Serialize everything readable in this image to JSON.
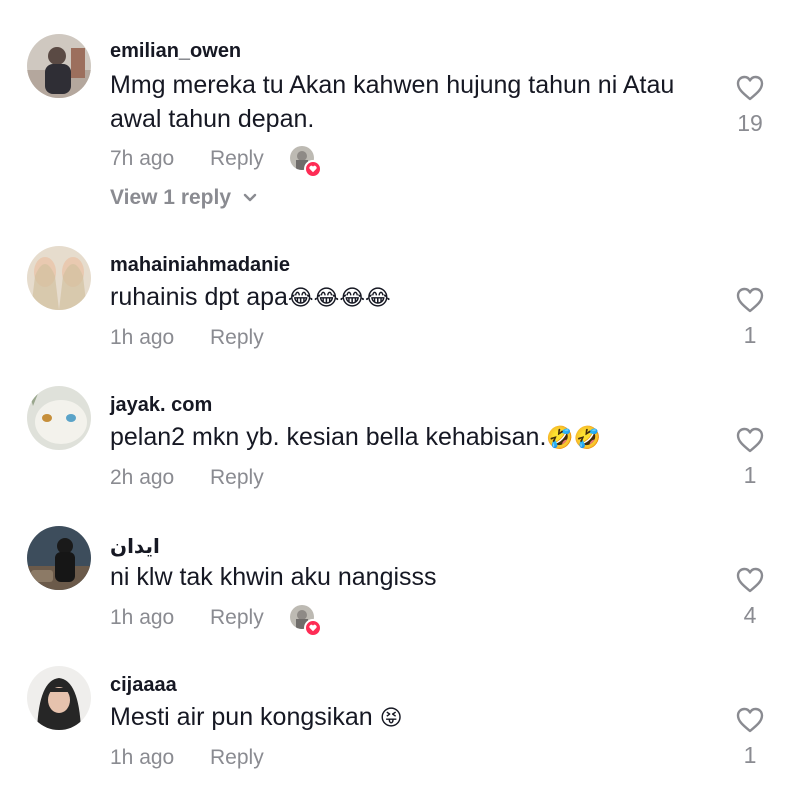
{
  "comments": [
    {
      "username": "emilian_owen",
      "text": "Mmg mereka tu Akan kahwen hujung tahun ni Atau awal tahun depan.",
      "time": "7h ago",
      "reply_label": "Reply",
      "likes": "19",
      "creator_liked": true,
      "view_replies": "View 1 reply",
      "avatar_colors": [
        "#c9c3bb",
        "#3b3a3f",
        "#9b6b5a"
      ]
    },
    {
      "username": "mahainiahmadanie",
      "text": "ruhainis dpt apa",
      "text_emoji": "😂😂😂😂",
      "time": "1h ago",
      "reply_label": "Reply",
      "likes": "1",
      "creator_liked": false,
      "avatar_colors": [
        "#d8cdb8",
        "#e8d9c6",
        "#c2a98a"
      ]
    },
    {
      "username": "jayak. com",
      "text": "pelan2 mkn yb. kesian bella kehabisan.",
      "text_emoji": "🤣🤣",
      "time": "2h ago",
      "reply_label": "Reply",
      "likes": "1",
      "creator_liked": false,
      "avatar_colors": [
        "#cfd3cc",
        "#e7e7e0",
        "#7f8c74"
      ]
    },
    {
      "username": "ايدان",
      "text": "ni klw tak khwin aku nangisss",
      "time": "1h ago",
      "reply_label": "Reply",
      "likes": "4",
      "creator_liked": true,
      "avatar_colors": [
        "#2c3e50",
        "#1c1c1c",
        "#7a8a9a"
      ]
    },
    {
      "username": "cijaaaa",
      "text": "Mesti air pun kongsikan",
      "text_emoji": "😝",
      "time": "1h ago",
      "reply_label": "Reply",
      "likes": "1",
      "creator_liked": false,
      "avatar_colors": [
        "#2a2a2a",
        "#e9d2c4",
        "#f0f0f0"
      ]
    }
  ],
  "colors": {
    "text": "#161823",
    "muted": "#8a8b91",
    "heart_badge": "#fe2c55"
  },
  "icons": {
    "like": "heart-outline-icon",
    "liked_by_creator": "heart-badge-icon",
    "expand": "chevron-down-icon"
  }
}
